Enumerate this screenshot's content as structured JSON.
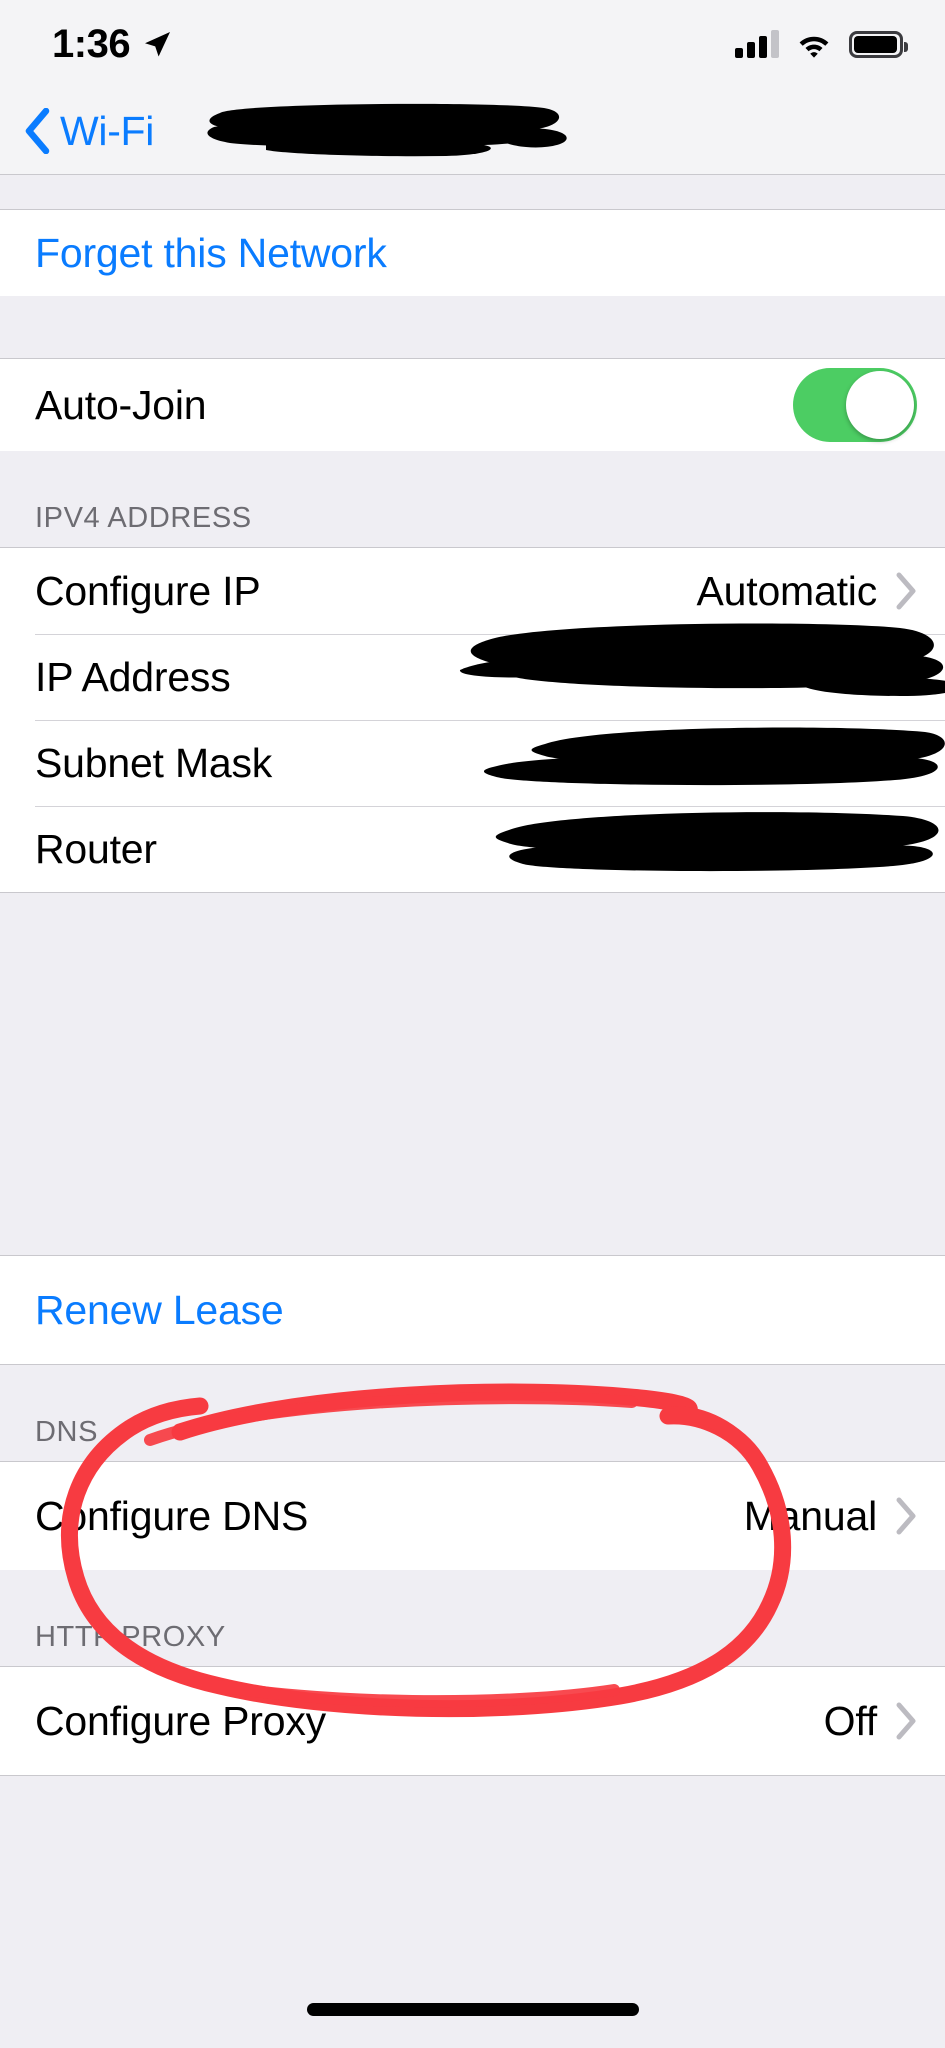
{
  "status_bar": {
    "time": "1:36",
    "location_icon": "location-arrow-icon",
    "cellular_icon": "cellular-signal-icon",
    "cellular_bars_filled": 3,
    "cellular_bars_total": 4,
    "wifi_icon": "wifi-icon",
    "battery_icon": "battery-icon",
    "battery_level_percent": 88
  },
  "nav": {
    "back_label": "Wi-Fi",
    "back_icon": "chevron-left-icon",
    "title": "",
    "title_redacted": true
  },
  "sections": [
    {
      "header": "",
      "rows": [
        {
          "label": "Forget this Network",
          "type": "link",
          "value": ""
        }
      ]
    },
    {
      "header": "",
      "rows": [
        {
          "label": "Auto-Join",
          "type": "toggle",
          "value": "on"
        }
      ]
    },
    {
      "header": "IPV4 ADDRESS",
      "rows": [
        {
          "label": "Configure IP",
          "type": "disclosure",
          "value": "Automatic"
        },
        {
          "label": "IP Address",
          "type": "redacted",
          "value": ""
        },
        {
          "label": "Subnet Mask",
          "type": "redacted",
          "value": ""
        },
        {
          "label": "Router",
          "type": "redacted",
          "value": ""
        }
      ]
    },
    {
      "header": "",
      "rows": [
        {
          "label": "Renew Lease",
          "type": "link",
          "value": ""
        }
      ]
    },
    {
      "header": "DNS",
      "rows": [
        {
          "label": "Configure DNS",
          "type": "disclosure",
          "value": "Manual"
        }
      ]
    },
    {
      "header": "HTTP PROXY",
      "rows": [
        {
          "label": "Configure Proxy",
          "type": "disclosure",
          "value": "Off"
        }
      ]
    }
  ],
  "labels": {
    "forget_network": "Forget this Network",
    "auto_join": "Auto-Join",
    "ipv4_header": "IPV4 ADDRESS",
    "configure_ip": "Configure IP",
    "configure_ip_value": "Automatic",
    "ip_address": "IP Address",
    "subnet_mask": "Subnet Mask",
    "router": "Router",
    "renew_lease": "Renew Lease",
    "dns_header": "DNS",
    "configure_dns": "Configure DNS",
    "configure_dns_value": "Manual",
    "http_proxy_header": "HTTP PROXY",
    "configure_proxy": "Configure Proxy",
    "configure_proxy_value": "Off"
  },
  "annotation": {
    "type": "hand-drawn-ellipse",
    "color": "#f73b41",
    "target": "Configure DNS",
    "stroke_width": 16
  },
  "colors": {
    "accent_blue": "#0a7cff",
    "toggle_green": "#4ccd63",
    "group_background": "#ffffff",
    "page_background": "#efeef3",
    "separator": "#d4d3d8",
    "header_text": "#6d6c72",
    "annotation_red": "#f73b41",
    "redaction_black": "#000000"
  }
}
